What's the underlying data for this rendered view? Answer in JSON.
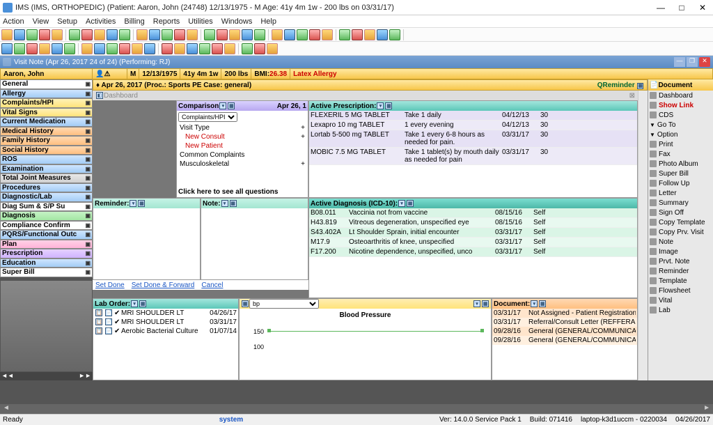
{
  "window": {
    "title": "IMS (IMS, ORTHOPEDIC)   (Patient: Aaron, John  (24748) 12/13/1975 - M Age: 41y 4m 1w - 200 lbs on 03/31/17)"
  },
  "menu": [
    "Action",
    "View",
    "Setup",
    "Activities",
    "Billing",
    "Reports",
    "Utilities",
    "Windows",
    "Help"
  ],
  "visit_tab": "Visit Note (Apr 26, 2017   24 of 24) (Performing: RJ)",
  "patient": {
    "name": "Aaron, John",
    "sex": "M",
    "dob": "12/13/1975",
    "age": "41y 4m 1w",
    "weight": "200 lbs",
    "bmi_label": "BMI:",
    "bmi": "26.38",
    "alert": "Latex Allergy"
  },
  "left_nav": [
    {
      "label": "General",
      "cls": "c-white"
    },
    {
      "label": "Allergy",
      "cls": "c-blue"
    },
    {
      "label": "Complaints/HPI",
      "cls": "c-yellow"
    },
    {
      "label": "Vital Signs",
      "cls": "c-yellow"
    },
    {
      "label": "Current Medication",
      "cls": "c-blue"
    },
    {
      "label": "Medical History",
      "cls": "c-orange"
    },
    {
      "label": "Family History",
      "cls": "c-orange"
    },
    {
      "label": "Social History",
      "cls": "c-orange"
    },
    {
      "label": "ROS",
      "cls": "c-blue"
    },
    {
      "label": "Examination",
      "cls": "c-blue"
    },
    {
      "label": "Total Joint Measures",
      "cls": "c-gray"
    },
    {
      "label": "Procedures",
      "cls": "c-blue"
    },
    {
      "label": "Diagnostic/Lab",
      "cls": "c-blue"
    },
    {
      "label": "Diag Sum & S/P Su",
      "cls": "c-white"
    },
    {
      "label": "Diagnosis",
      "cls": "c-green"
    },
    {
      "label": "Compliance Confirm",
      "cls": "c-white"
    },
    {
      "label": "PQRS/Functional Outc",
      "cls": "c-blue"
    },
    {
      "label": "Plan",
      "cls": "c-pink"
    },
    {
      "label": "Prescription",
      "cls": "c-purple"
    },
    {
      "label": "Education",
      "cls": "c-blue"
    },
    {
      "label": "Super Bill",
      "cls": "c-white"
    }
  ],
  "note_header": "Apr 26, 2017  (Proc.: Sports PE  Case: general)",
  "qreminder": "QReminder",
  "dashboard_label": "Dashboard",
  "comparison": {
    "title": "Comparison",
    "date": "Apr 26, 1",
    "select": "Complaints/HPI",
    "rows": [
      {
        "label": "Visit Type",
        "val": "+",
        "red": false
      },
      {
        "label": "New Consult",
        "val": "+",
        "red": true
      },
      {
        "label": "New Patient",
        "val": "",
        "red": true
      },
      {
        "label": "Common Complaints",
        "val": "",
        "red": false
      },
      {
        "label": "Musculoskeletal",
        "val": "+",
        "red": false
      }
    ],
    "footer": "Click here to see all questions"
  },
  "active_rx": {
    "title": "Active Prescription:",
    "rows": [
      {
        "drug": "FLEXERIL 5 MG TABLET",
        "dose": "Take 1 daily",
        "date": "04/12/13",
        "qty": "30"
      },
      {
        "drug": "Lexapro 10 mg TABLET",
        "dose": "1 every evening",
        "date": "04/12/13",
        "qty": "30"
      },
      {
        "drug": "Lortab 5-500 mg TABLET",
        "dose": "Take 1 every 6-8 hours as needed for pain.",
        "date": "03/31/17",
        "qty": "30"
      },
      {
        "drug": "MOBIC 7.5 MG TABLET",
        "dose": "Take 1 tablet(s) by mouth daily as needed for pain",
        "date": "03/31/17",
        "qty": "30"
      }
    ]
  },
  "reminder_hdr": "Reminder:",
  "note_hdr": "Note:",
  "active_dx": {
    "title": "Active Diagnosis (ICD-10):",
    "rows": [
      {
        "code": "B08.011",
        "desc": "Vaccinia not from vaccine",
        "date": "08/15/16",
        "src": "Self"
      },
      {
        "code": "H43.819",
        "desc": "Vitreous degeneration, unspecified eye",
        "date": "08/15/16",
        "src": "Self"
      },
      {
        "code": "S43.402A",
        "desc": "Lt Shoulder Sprain, initial encounter",
        "date": "03/31/17",
        "src": "Self"
      },
      {
        "code": "M17.9",
        "desc": "Osteoarthritis of knee, unspecified",
        "date": "03/31/17",
        "src": "Self"
      },
      {
        "code": "F17.200",
        "desc": "Nicotine dependence, unspecified, unco",
        "date": "03/31/17",
        "src": "Self"
      }
    ]
  },
  "links": {
    "done": "Set Done",
    "fwd": "Set Done & Forward",
    "cancel": "Cancel"
  },
  "lab_order": {
    "title": "Lab Order:",
    "rows": [
      {
        "name": "MRI SHOULDER LT",
        "date": "04/26/17"
      },
      {
        "name": "MRI SHOULDER LT",
        "date": "03/31/17"
      },
      {
        "name": "Aerobic Bacterial Culture",
        "date": "01/07/14"
      }
    ]
  },
  "chart": {
    "select": "bp",
    "title": "Blood Pressure",
    "y_ticks": [
      "150",
      "100"
    ]
  },
  "documents": {
    "title": "Document:",
    "rows": [
      {
        "date": "03/31/17",
        "desc": "Not Assigned - Patient Registration"
      },
      {
        "date": "03/31/17",
        "desc": "Referral/Consult Letter (REFFERALS"
      },
      {
        "date": "09/28/16",
        "desc": "General (GENERAL/COMMUNICAT"
      },
      {
        "date": "09/28/16",
        "desc": "General (GENERAL/COMMUNICAT"
      }
    ]
  },
  "right_pane": {
    "header": "Document",
    "items": [
      {
        "label": "Dashboard"
      },
      {
        "label": "Show Link",
        "red": true
      },
      {
        "label": "CDS"
      },
      {
        "label": "Go To",
        "arrow": "▼"
      },
      {
        "label": "Option",
        "arrow": "▼"
      },
      {
        "label": "Print"
      },
      {
        "label": "Fax"
      },
      {
        "label": "Photo Album"
      },
      {
        "label": "Super Bill"
      },
      {
        "label": "Follow Up"
      },
      {
        "label": "Letter"
      },
      {
        "label": "Summary"
      },
      {
        "label": "Sign Off"
      },
      {
        "label": "Copy Template"
      },
      {
        "label": "Copy Prv. Visit"
      },
      {
        "label": "Note"
      },
      {
        "label": "Image"
      },
      {
        "label": "Prvt. Note"
      },
      {
        "label": "Reminder"
      },
      {
        "label": "Template"
      },
      {
        "label": "Flowsheet"
      },
      {
        "label": "Vital"
      },
      {
        "label": "Lab"
      }
    ]
  },
  "status": {
    "ready": "Ready",
    "system": "system",
    "ver": "Ver: 14.0.0 Service Pack 1",
    "build": "Build: 071416",
    "host": "laptop-k3d1uccm - 0220034",
    "date": "04/26/2017"
  }
}
